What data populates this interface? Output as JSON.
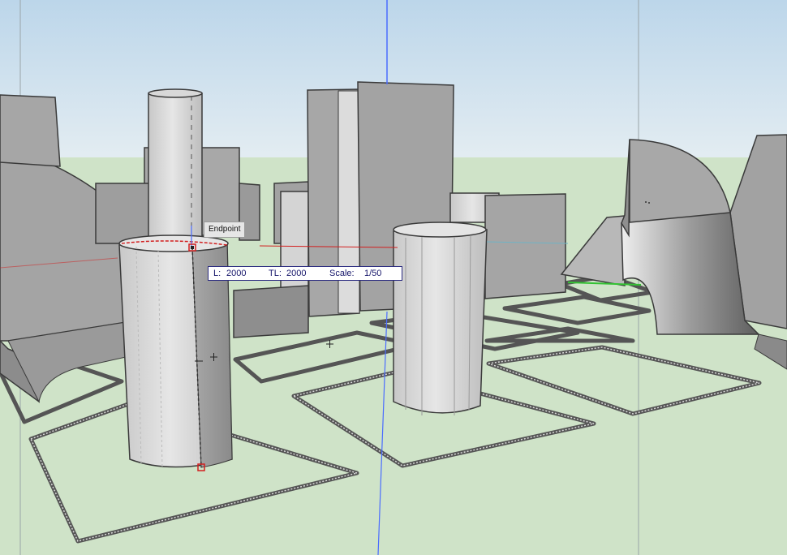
{
  "viewport": {
    "snap_tooltip": "Endpoint",
    "measure_bar": {
      "length_label": "L:",
      "length_value": "2000",
      "total_length_label": "TL:",
      "total_length_value": "2000",
      "scale_label": "Scale:",
      "scale_value": "1/50"
    },
    "colors": {
      "sky_top": "#bcd6ea",
      "sky_bottom": "#e4edf2",
      "ground": "#cfe3c8",
      "solid_face": "#a3a3a3",
      "solid_light": "#d2d2d2",
      "edge": "#3a3a3a",
      "blue_axis": "#4a6cff",
      "selection_red": "#d21f1f"
    }
  }
}
